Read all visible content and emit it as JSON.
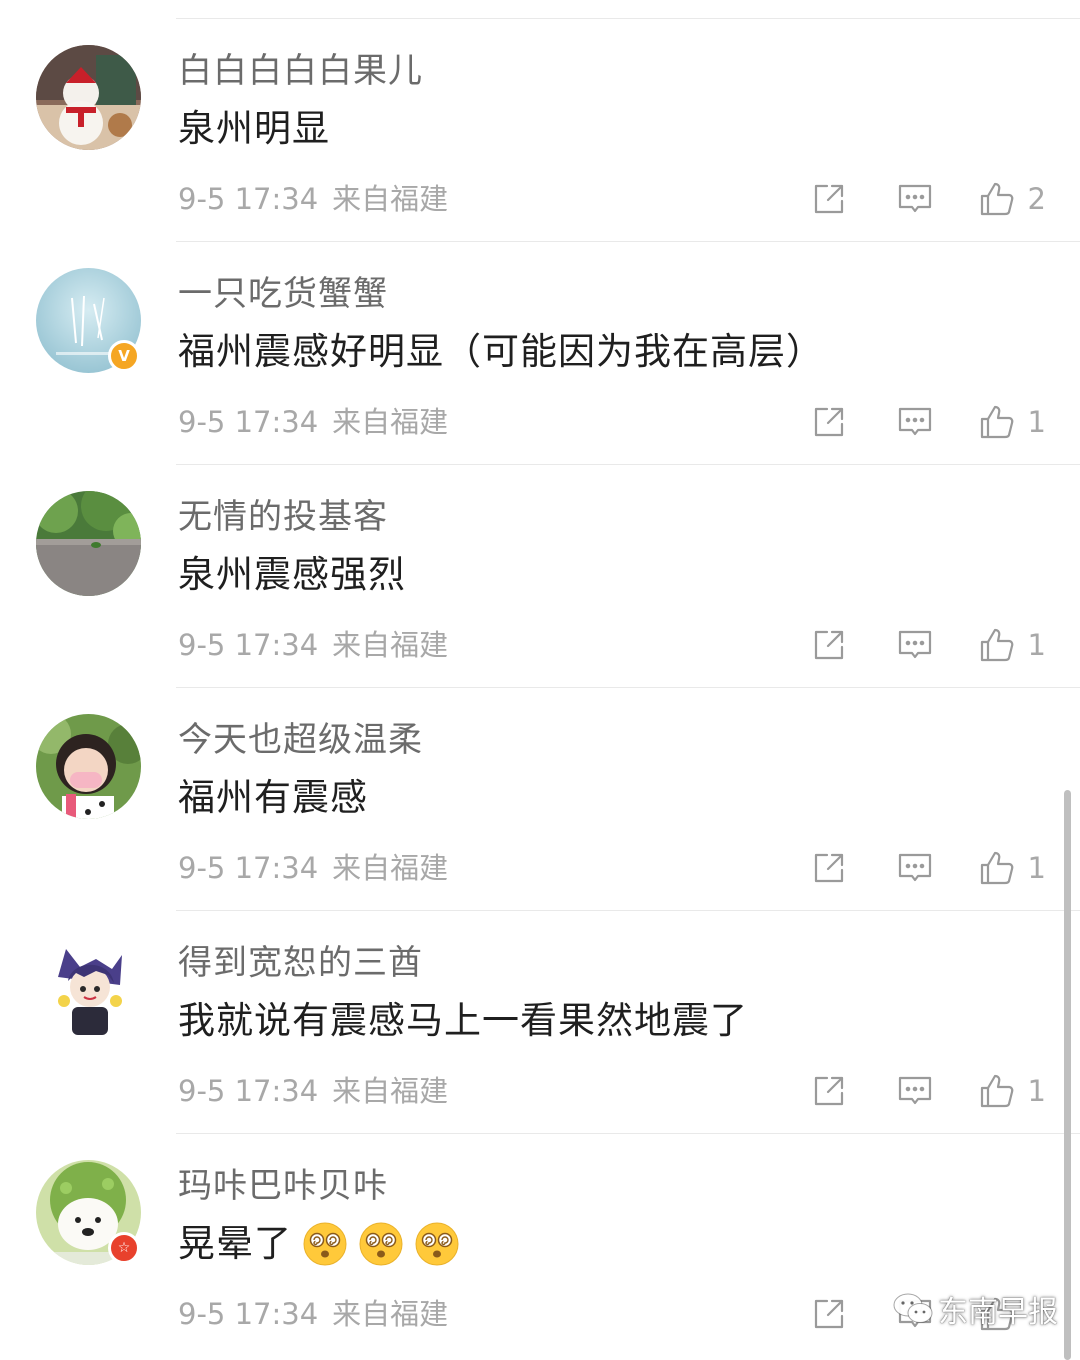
{
  "comments": [
    {
      "username": "白白白白白果儿",
      "content": "泉州明显",
      "timestamp": "9-5 17:34",
      "location": "来自福建",
      "likes": "2",
      "badge": "",
      "emoji_count": 0
    },
    {
      "username": "一只吃货蟹蟹",
      "content": "福州震感好明显（可能因为我在高层）",
      "timestamp": "9-5 17:34",
      "location": "来自福建",
      "likes": "1",
      "badge": "vip",
      "emoji_count": 0
    },
    {
      "username": "无情的投基客",
      "content": "泉州震感强烈",
      "timestamp": "9-5 17:34",
      "location": "来自福建",
      "likes": "1",
      "badge": "",
      "emoji_count": 0
    },
    {
      "username": "今天也超级温柔",
      "content": "福州有震感",
      "timestamp": "9-5 17:34",
      "location": "来自福建",
      "likes": "1",
      "badge": "",
      "emoji_count": 0
    },
    {
      "username": "得到宽恕的三酋",
      "content": "我就说有震感马上一看果然地震了",
      "timestamp": "9-5 17:34",
      "location": "来自福建",
      "likes": "1",
      "badge": "",
      "emoji_count": 0
    },
    {
      "username": "玛咔巴咔贝咔",
      "content": "晃晕了",
      "timestamp": "9-5 17:34",
      "location": "来自福建",
      "likes": "",
      "badge": "star",
      "emoji_count": 3,
      "emoji_name": "dizzy-face-emoji"
    }
  ],
  "watermark": {
    "text": "东南早报",
    "icon": "wechat-icon"
  },
  "icons": {
    "share": "share-icon",
    "reply": "reply-icon",
    "like": "thumbs-up-icon"
  },
  "colors": {
    "badge_vip": "#f5a623",
    "badge_star": "#e8412c",
    "meta_text": "#a8a8a8"
  }
}
